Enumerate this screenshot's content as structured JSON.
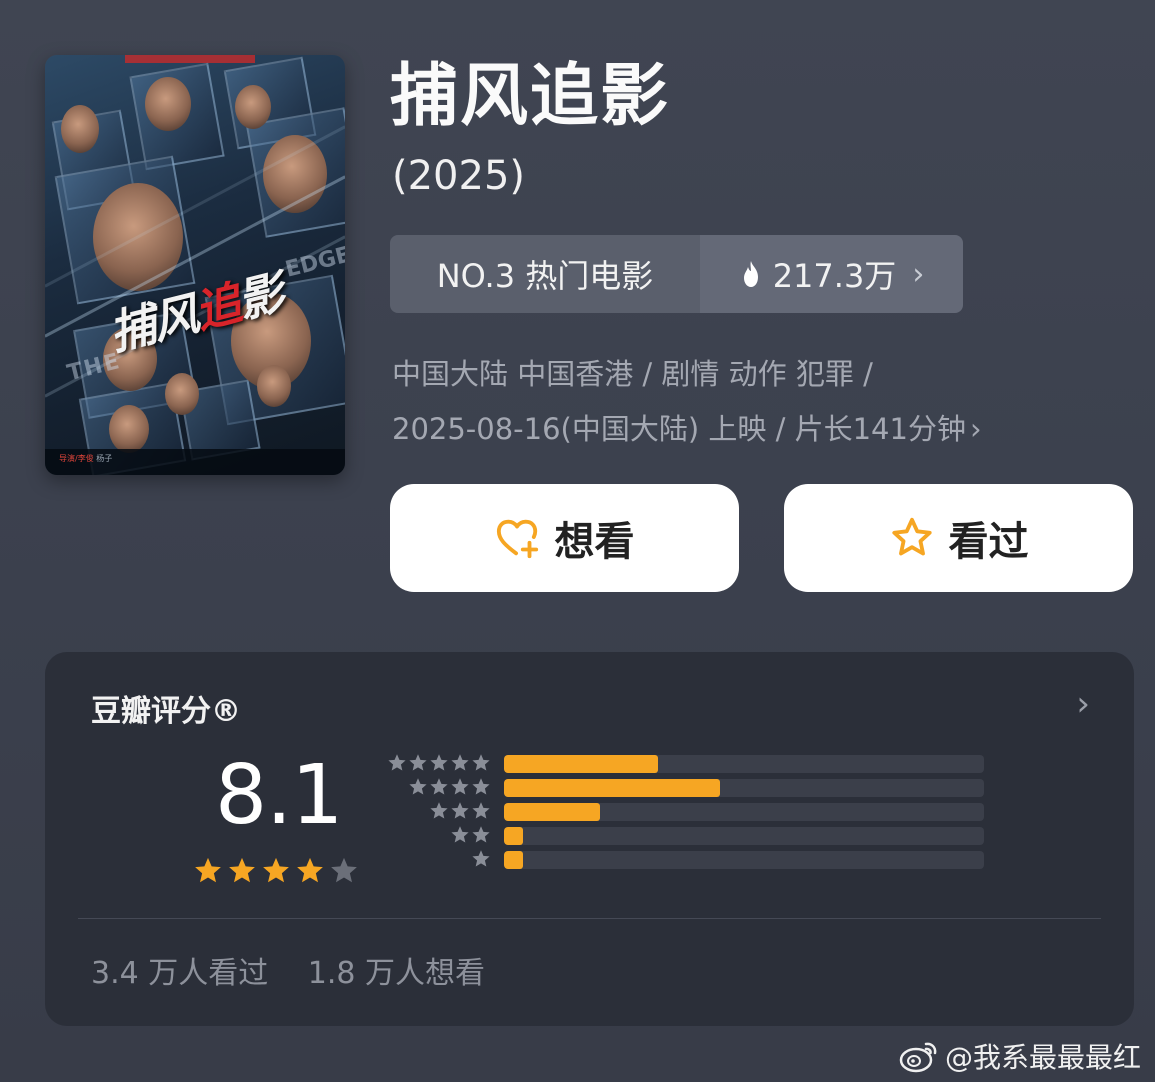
{
  "movie": {
    "title": "捕风追影",
    "year": "(2025)",
    "poster_title_parts": [
      "捕风",
      "追",
      "影"
    ],
    "poster_en_text": "THE",
    "poster_en_text2": "EDGE",
    "poster_credits_highlight": "导演/李俊",
    "poster_credits_name": "杨子"
  },
  "rank": {
    "label": "NO.3 热门电影",
    "heat": "217.3万",
    "heat_icon": "flame-icon"
  },
  "meta": {
    "line1": "中国大陆 中国香港 / 剧情 动作 犯罪 /",
    "line2": "2025-08-16(中国大陆) 上映 / 片长141分钟",
    "chevron": "›"
  },
  "actions": {
    "want_label": "想看",
    "seen_label": "看过",
    "want_icon": "heart-plus-icon",
    "seen_icon": "star-outline-icon"
  },
  "rating": {
    "title": "豆瓣评分®",
    "score": "8.1",
    "stars": 4.0,
    "distribution": [
      {
        "stars": 5,
        "fraction": 0.32
      },
      {
        "stars": 4,
        "fraction": 0.45
      },
      {
        "stars": 3,
        "fraction": 0.2
      },
      {
        "stars": 2,
        "fraction": 0.04
      },
      {
        "stars": 1,
        "fraction": 0.04
      }
    ],
    "seen_count": "3.4 万人看过",
    "want_count": "1.8 万人想看"
  },
  "watermark": {
    "text": "@我系最最最红",
    "icon": "weibo-icon"
  },
  "colors": {
    "accent": "#f6a623",
    "card_bg": "#2b2f39",
    "page_bg": "#3e4350"
  }
}
